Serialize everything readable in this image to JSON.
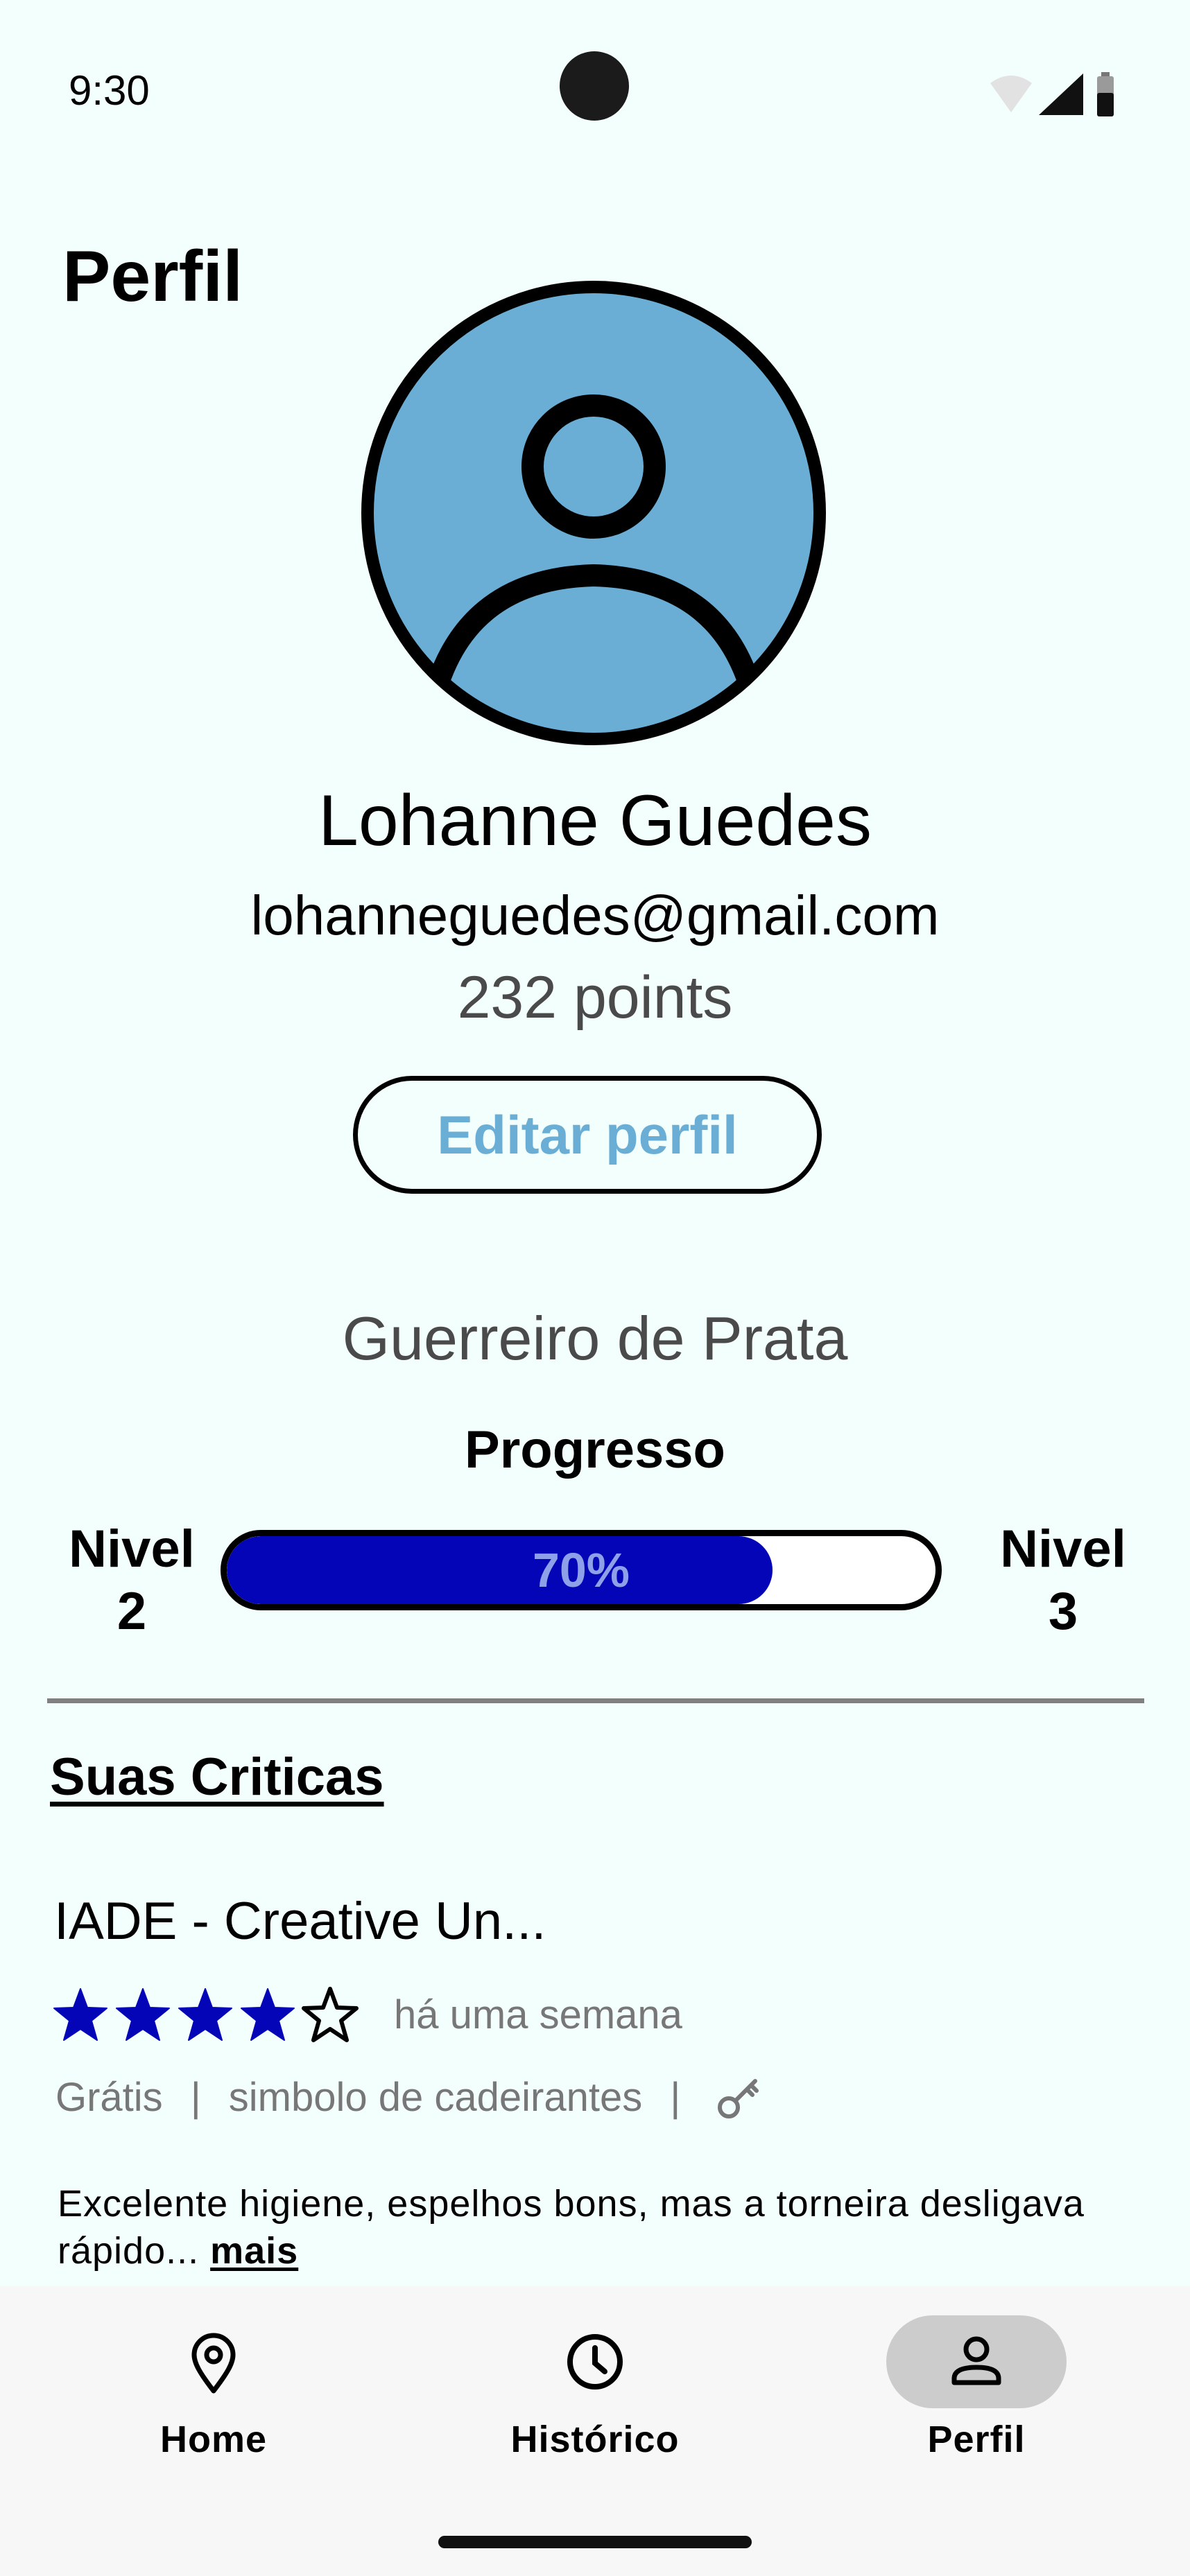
{
  "status_bar": {
    "time": "9:30"
  },
  "header": {
    "title": "Perfil"
  },
  "profile": {
    "name": "Lohanne Guedes",
    "email": "lohanneguedes@gmail.com",
    "points": "232 points",
    "edit_label": "Editar perfil",
    "avatar_color": "#6BAED5"
  },
  "rank": {
    "title": "Guerreiro de Prata",
    "progress_label": "Progresso",
    "current_level": "Nivel\n2",
    "next_level": "Nivel\n3",
    "progress_text": "70%",
    "progress_fraction": 0.77,
    "bar_color": "#0505B8"
  },
  "reviews": {
    "section_title": "Suas Criticas",
    "items": [
      {
        "place": "IADE - Creative Un...",
        "rating": 4,
        "max_rating": 5,
        "time": "há uma semana",
        "tags": [
          "Grátis",
          "simbolo de cadeirantes"
        ],
        "text": "Excelente higiene, espelhos bons, mas a torneira desligava rápido... ",
        "more_label": "mais"
      }
    ]
  },
  "nav": {
    "items": [
      {
        "label": "Home",
        "icon": "location-pin-icon"
      },
      {
        "label": "Histórico",
        "icon": "clock-icon"
      },
      {
        "label": "Perfil",
        "icon": "person-icon",
        "active": true
      }
    ]
  }
}
